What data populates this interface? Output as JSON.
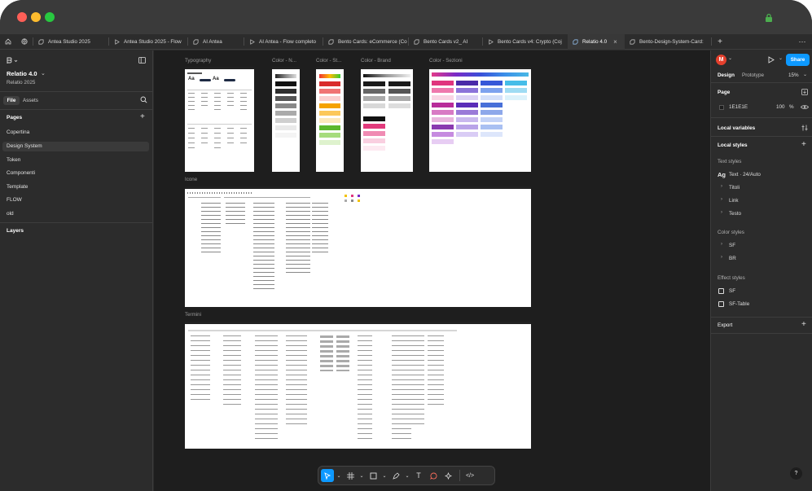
{
  "tabs": [
    {
      "label": "Antea Studio 2025"
    },
    {
      "label": "Antea Studio 2025 - Flow"
    },
    {
      "label": "AI Antea"
    },
    {
      "label": "AI Antea - Flow completo"
    },
    {
      "label": "Bento Cards: eCommerce (Co"
    },
    {
      "label": "Bento Cards v2_ AI"
    },
    {
      "label": "Bento Cards v4: Crypto (Coj"
    },
    {
      "label": "Relatio 4.0"
    },
    {
      "label": "Bento-Design-System-Card:"
    }
  ],
  "file": {
    "name": "Relatio 4.0",
    "project": "Relatio 2025"
  },
  "left": {
    "file_tab": "File",
    "assets_tab": "Assets",
    "pages_header": "Pages",
    "pages": [
      "Copertina",
      "Design System",
      "Token",
      "Componenti",
      "Template",
      "FLOW",
      "old"
    ],
    "layers_header": "Layers"
  },
  "frames": {
    "typography": "Typography",
    "color_n": "Color - N...",
    "color_st": "Color - St...",
    "color_brand": "Color - Brand",
    "color_sezioni": "Color - Sezioni",
    "icone": "Icone",
    "termini": "Termini"
  },
  "right": {
    "avatar": "M",
    "share": "Share",
    "design_tab": "Design",
    "prototype_tab": "Prototype",
    "zoom": "15%",
    "page_header": "Page",
    "page_color": "1E1E1E",
    "page_opacity": "100",
    "pct": "%",
    "local_variables": "Local variables",
    "local_styles": "Local styles",
    "text_styles": "Text styles",
    "text_style_main": "Text · 24/Auto",
    "text_style_groups": [
      "Titoli",
      "Link",
      "Testo"
    ],
    "color_styles": "Color styles",
    "color_groups": [
      "SF",
      "BR"
    ],
    "effect_styles": "Effect styles",
    "effects": [
      "SF",
      "SF-Table"
    ],
    "export": "Export",
    "help": "?"
  },
  "colors": {
    "accent": "#0d99ff",
    "canvas": "#1e1e1e",
    "panel": "#2c2c2c",
    "avatar": "#e5402d",
    "lock": "#4cae4f"
  }
}
